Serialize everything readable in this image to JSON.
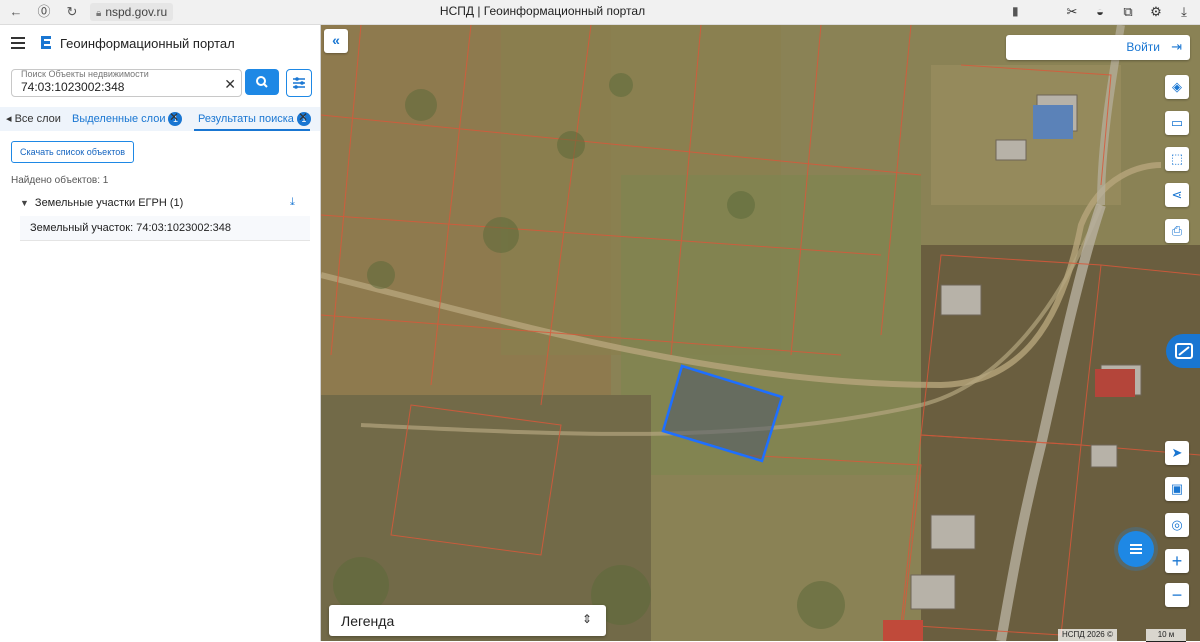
{
  "browser": {
    "url": "nspd.gov.ru",
    "tab_title": "НСПД | Геоинформационный портал"
  },
  "app": {
    "title": "Геоинформационный портал"
  },
  "search": {
    "label": "Поиск Объекты недвижимости",
    "value": "74:03:1023002:348"
  },
  "tabs": {
    "all": "Все слои",
    "selected": "Выделенные слои",
    "selected_count": "1",
    "results": "Результаты поиска",
    "results_count": "1"
  },
  "results": {
    "download_label": "Скачать список объектов",
    "found": "Найдено объектов: 1",
    "group": "Земельные участки ЕГРН (1)",
    "item": "Земельный участок: 74:03:1023002:348"
  },
  "map": {
    "login": "Войти",
    "legend": "Легенда",
    "attribution": "НСПД 2026 ©",
    "scale": "10 м",
    "selection_color": "#1e6fff",
    "boundary_color": "#d9583a"
  },
  "icons": {
    "collapse": "chevrons-left-icon",
    "layers": "layers-icon",
    "ruler": "ruler-icon",
    "select-area": "select-area-icon",
    "share": "share-icon",
    "print": "print-icon",
    "locate": "locate-icon",
    "basemap": "basemap-icon",
    "location": "location-icon",
    "zoom-in": "plus-icon",
    "zoom-out": "minus-icon"
  }
}
